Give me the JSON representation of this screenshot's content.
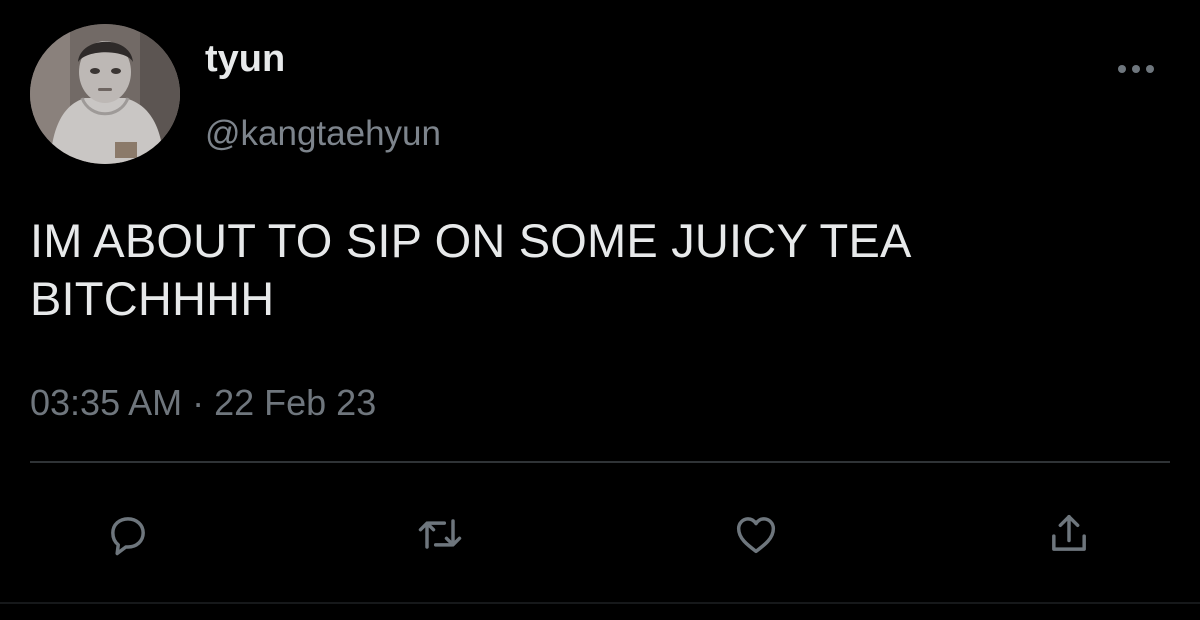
{
  "tweet": {
    "display_name": "tyun",
    "handle": "@kangtaehyun",
    "text_line1": "IM ABOUT TO SIP ON SOME JUICY TEA",
    "text_line2": "BITCHHHH",
    "timestamp": "03:35 AM · 22 Feb 23"
  },
  "actions": {
    "reply_icon": "reply-icon",
    "retweet_icon": "retweet-icon",
    "like_icon": "heart-icon",
    "share_icon": "share-icon"
  },
  "colors": {
    "background": "#000000",
    "primary_text": "#e7e9ea",
    "secondary_text": "#7d848c",
    "icon": "#6e767d",
    "divider": "#2f3336"
  }
}
